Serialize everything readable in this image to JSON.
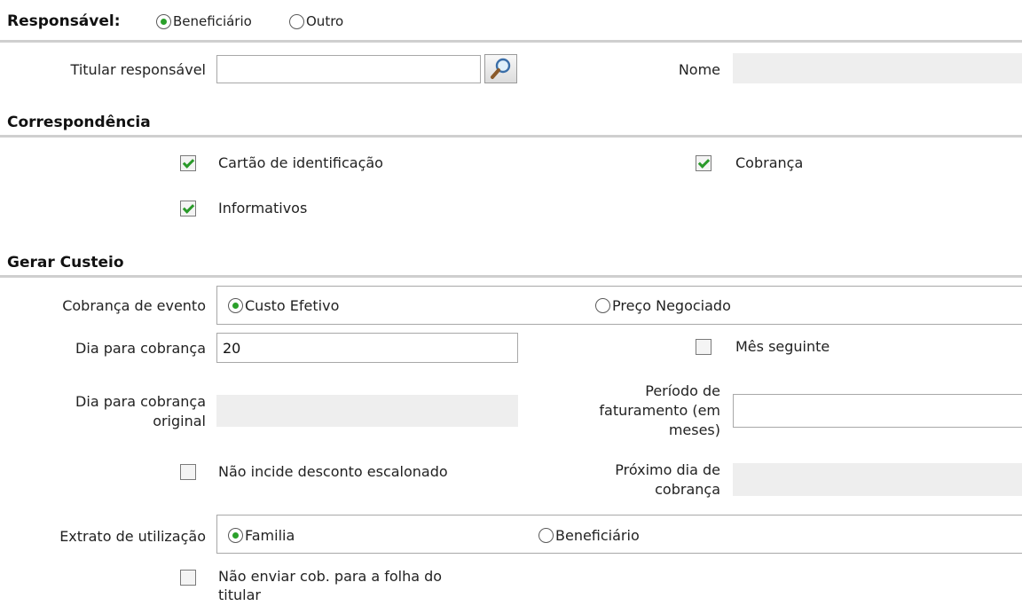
{
  "responsavel": {
    "label": "Responsável:",
    "options": [
      "Beneficiário",
      "Outro"
    ],
    "selected": "Beneficiário",
    "titular_label": "Titular responsável",
    "titular_value": "",
    "nome_label": "Nome",
    "nome_value": ""
  },
  "correspondencia": {
    "title": "Correspondência",
    "cartao": "Cartão de identificação",
    "cobranca": "Cobrança",
    "informativos": "Informativos"
  },
  "custeio": {
    "title": "Gerar Custeio",
    "cobranca_evento_label": "Cobrança de evento",
    "cobranca_evento_options": [
      "Custo Efetivo",
      "Preço Negociado"
    ],
    "cobranca_evento_selected": "Custo Efetivo",
    "dia_cobranca_label": "Dia para cobrança",
    "dia_cobranca_value": "20",
    "mes_seguinte": "Mês seguinte",
    "dia_original_label_1": "Dia para cobrança",
    "dia_original_label_2": "original",
    "periodo_label_1": "Período de",
    "periodo_label_2": "faturamento (em",
    "periodo_label_3": "meses)",
    "periodo_value": "",
    "nao_incide": "Não incide desconto escalonado",
    "proximo_label_1": "Próximo dia de",
    "proximo_label_2": "cobrança",
    "extrato_label": "Extrato de utilização",
    "extrato_options": [
      "Familia",
      "Beneficiário"
    ],
    "extrato_selected": "Familia",
    "nao_enviar_1": "Não enviar cob. para a folha do",
    "nao_enviar_2": "titular"
  },
  "colors": {
    "check_green": "#2a9a2a",
    "divider": "#cfcfcf",
    "readonly_bg": "#eeeeee"
  }
}
